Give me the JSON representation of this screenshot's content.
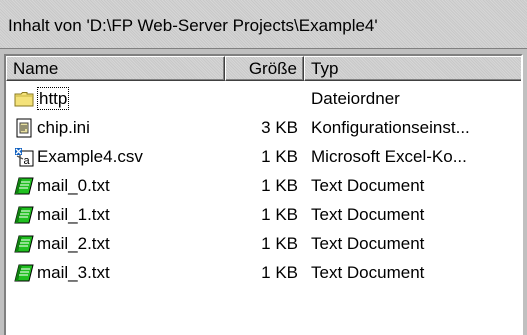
{
  "window": {
    "title": "Inhalt von 'D:\\FP Web-Server Projects\\Example4'"
  },
  "columns": {
    "name": "Name",
    "size": "Größe",
    "type": "Typ"
  },
  "files": [
    {
      "icon": "folder-icon",
      "name": "http",
      "size": "",
      "type": "Dateiordner"
    },
    {
      "icon": "config-file-icon",
      "name": "chip.ini",
      "size": "3 KB",
      "type": "Konfigurationseinst..."
    },
    {
      "icon": "excel-csv-icon",
      "name": "Example4.csv",
      "size": "1 KB",
      "type": "Microsoft Excel-Ko..."
    },
    {
      "icon": "text-document-icon",
      "name": "mail_0.txt",
      "size": "1 KB",
      "type": "Text Document"
    },
    {
      "icon": "text-document-icon",
      "name": "mail_1.txt",
      "size": "1 KB",
      "type": "Text Document"
    },
    {
      "icon": "text-document-icon",
      "name": "mail_2.txt",
      "size": "1 KB",
      "type": "Text Document"
    },
    {
      "icon": "text-document-icon",
      "name": "mail_3.txt",
      "size": "1 KB",
      "type": "Text Document"
    }
  ],
  "colors": {
    "panel": "#c0c0c0",
    "list_background": "#ffffff",
    "folder": "#f4e27a",
    "notepad_green": "#20c020"
  }
}
